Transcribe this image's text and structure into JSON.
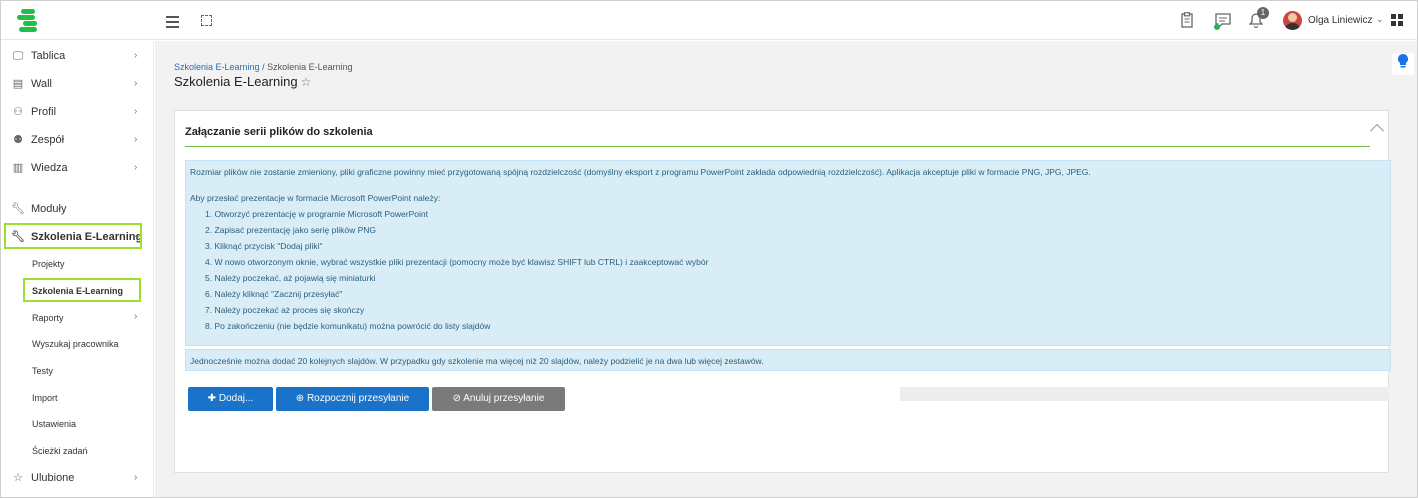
{
  "topbar": {
    "username": "Olga Liniewicz",
    "notifications_count": "1",
    "icons": [
      "menu-icon",
      "fullscreen-icon",
      "clipboard-icon",
      "chat-icon",
      "bell-icon",
      "apps-grid-icon"
    ]
  },
  "sidebar": {
    "items": [
      {
        "label": "Tablica",
        "icon": "monitor-icon"
      },
      {
        "label": "Wall",
        "icon": "wall-icon"
      },
      {
        "label": "Profil",
        "icon": "user-icon"
      },
      {
        "label": "Zespół",
        "icon": "team-icon"
      },
      {
        "label": "Wiedza",
        "icon": "book-icon"
      },
      {
        "label": "Moduły",
        "icon": "wrench-icon"
      },
      {
        "label": "Szkolenia E-Learning",
        "icon": "wrench-icon"
      }
    ],
    "sub_items": [
      "Projekty",
      "Szkolenia E-Learning",
      "Raporty",
      "Wyszukaj pracownika",
      "Testy",
      "Import",
      "Ustawienia",
      "Ścieżki zadań"
    ],
    "favorites": "Ulubione"
  },
  "header": {
    "breadcrumb_link": "Szkolenia E-Learning",
    "breadcrumb_current": " / Szkolenia E-Learning",
    "title": "Szkolenia E-Learning"
  },
  "card": {
    "title": "Załączanie serii plików do szkolenia",
    "info_para1": "Rozmiar plików nie zostanie zmieniony, pliki graficzne powinny mieć przygotowaną spójną rozdzielczość (domyślny eksport z programu PowerPoint zakłada odpowiednią rozdzielczość). Aplikacja akceptuje pliki w formacie PNG, JPG, JPEG.",
    "info_para2": "Aby przesłać prezentacje w formacie Microsoft PowerPoint należy:",
    "steps": [
      "1. Otworzyć prezentację w programie Microsoft PowerPoint",
      "2. Zapisać prezentację jako serię plików PNG",
      "3. Kliknąć przycisk \"Dodaj pliki\"",
      "4. W nowo otworzonym oknie, wybrać wszystkie pliki prezentacji (pomocny może być klawisz SHIFT lub CTRL) i zaakceptować wybór",
      "5. Należy poczekać, aż pojawią się miniaturki",
      "6. Należy kliknąć \"Zacznij przesyłać\"",
      "7. Należy poczekać aż proces się skończy",
      "8. Po zakończeniu (nie będzie komunikatu) można powrócić do listy slajdów"
    ],
    "info_note": "Jednocześnie można dodać 20 kolejnych slajdów. W przypadku gdy szkolenie ma więcej niż 20 slajdów, należy podzielić je na dwa lub więcej zestawów.",
    "buttons": {
      "add": "Dodaj...",
      "start": "Rozpocznij przesyłanie",
      "cancel": "Anuluj przesyłanie"
    },
    "progress": 0
  },
  "colors": {
    "accent": "#1a73c8",
    "highlight": "#9be02d",
    "info_bg": "#d9edf7"
  }
}
